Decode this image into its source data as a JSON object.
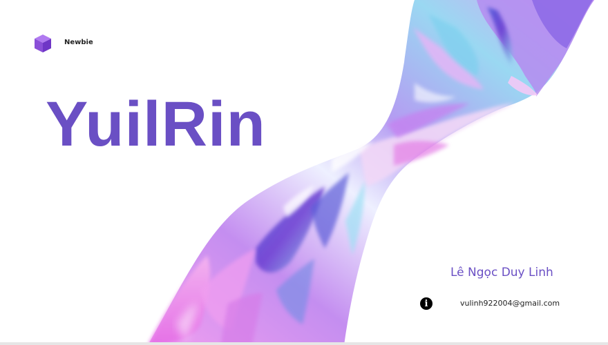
{
  "brand": {
    "logo_icon": "cube-icon",
    "label": "Newbie"
  },
  "hero": {
    "title": "YuilRin"
  },
  "contact": {
    "name": "Lê Ngọc Duy Linh",
    "info_icon": "info-icon",
    "email": "vulinh922004@gmail.com"
  },
  "colors": {
    "accent": "#6a4fc4",
    "logo": "#9b55e0"
  }
}
